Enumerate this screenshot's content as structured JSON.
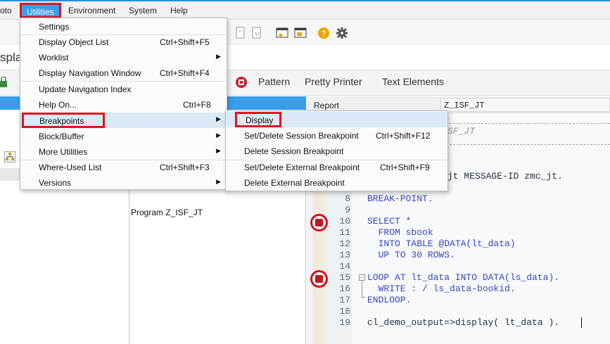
{
  "menubar": {
    "goto_partial": "oto",
    "utilities": "Utilities",
    "environment": "Environment",
    "system": "System",
    "help": "Help"
  },
  "title": {
    "partial": "splay"
  },
  "app_toolbar": {
    "pattern": "Pattern",
    "pretty_printer": "Pretty Printer",
    "text_elements": "Text Elements"
  },
  "utilities_menu": {
    "items": [
      {
        "label": "Settings",
        "shortcut": ""
      },
      {
        "label": "Display Object List",
        "shortcut": "Ctrl+Shift+F5"
      },
      {
        "label": "Worklist",
        "shortcut": ""
      },
      {
        "label": "Display Navigation Window",
        "shortcut": "Ctrl+Shift+F4"
      },
      {
        "label": "Update Navigation Index",
        "shortcut": ""
      },
      {
        "label": "Help On...",
        "shortcut": "Ctrl+F8"
      },
      {
        "label": "Breakpoints",
        "shortcut": ""
      },
      {
        "label": "Block/Buffer",
        "shortcut": ""
      },
      {
        "label": "More Utilities",
        "shortcut": ""
      },
      {
        "label": "Where-Used List",
        "shortcut": "Ctrl+Shift+F3"
      },
      {
        "label": "Versions",
        "shortcut": ""
      }
    ]
  },
  "breakpoints_menu": {
    "items": [
      {
        "label": "Display",
        "shortcut": ""
      },
      {
        "label": "Set/Delete Session Breakpoint",
        "shortcut": "Ctrl+Shift+F12"
      },
      {
        "label": "Delete Session Breakpoint",
        "shortcut": ""
      },
      {
        "label": "Set/Delete External Breakpoint",
        "shortcut": "Ctrl+Shift+F9"
      },
      {
        "label": "Delete External Breakpoint",
        "shortcut": ""
      }
    ]
  },
  "middle_pane": {
    "program_label": "Program Z_ISF_JT"
  },
  "editor": {
    "report_label": "Report",
    "report_value": "Z_ISF_JT",
    "comment_partial": "SF_JT",
    "report_line_tail": "jt MESSAGE-ID zmc_jt.",
    "lines": [
      {
        "n": "8",
        "t": "BREAK-POINT."
      },
      {
        "n": "9",
        "t": ""
      },
      {
        "n": "10",
        "t": "SELECT *"
      },
      {
        "n": "11",
        "t": "  FROM sbook"
      },
      {
        "n": "12",
        "t": "  INTO TABLE @DATA(lt_data)"
      },
      {
        "n": "13",
        "t": "  UP TO 30 ROWS."
      },
      {
        "n": "14",
        "t": ""
      },
      {
        "n": "15",
        "t": "LOOP AT lt_data INTO DATA(ls_data)."
      },
      {
        "n": "16",
        "t": "  WRITE : / ls_data-bookid."
      },
      {
        "n": "17",
        "t": "ENDLOOP."
      },
      {
        "n": "18",
        "t": ""
      },
      {
        "n": "19",
        "t": "cl_demo_output=>display( lt_data )."
      }
    ]
  },
  "colors": {
    "accent": "#3a9de9",
    "annotation": "#e0141e"
  }
}
